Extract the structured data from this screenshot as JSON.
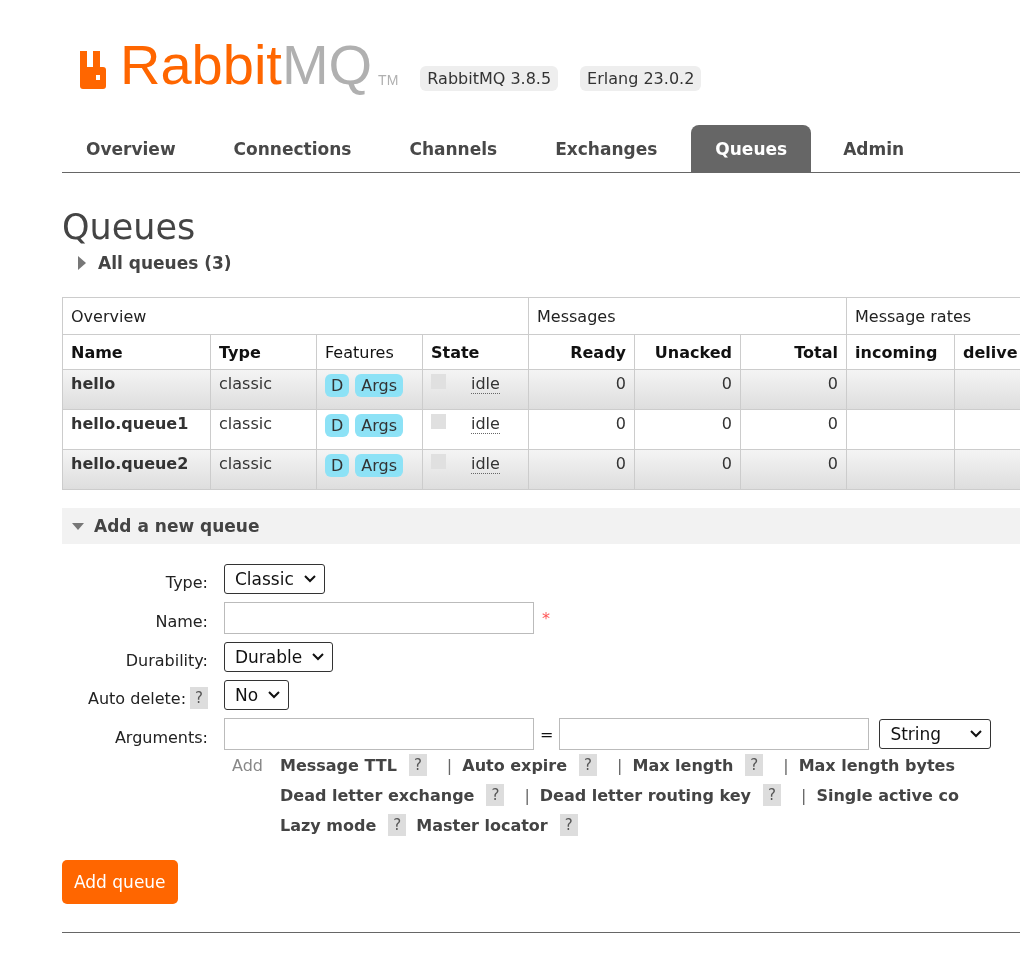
{
  "logo": {
    "brand": "Rabbit",
    "product": "MQ",
    "mark": "TM"
  },
  "versions": [
    "RabbitMQ 3.8.5",
    "Erlang 23.0.2"
  ],
  "tabs": [
    {
      "label": "Overview",
      "selected": false
    },
    {
      "label": "Connections",
      "selected": false
    },
    {
      "label": "Channels",
      "selected": false
    },
    {
      "label": "Exchanges",
      "selected": false
    },
    {
      "label": "Queues",
      "selected": true
    },
    {
      "label": "Admin",
      "selected": false
    }
  ],
  "page_title": "Queues",
  "all_queues": {
    "label": "All queues (3)",
    "expanded": false
  },
  "table": {
    "groups": [
      "Overview",
      "Messages",
      "Message rates"
    ],
    "columns": [
      "Name",
      "Type",
      "Features",
      "State",
      "Ready",
      "Unacked",
      "Total",
      "incoming",
      "delive"
    ],
    "rows": [
      {
        "name": "hello",
        "type": "classic",
        "features": [
          "D",
          "Args"
        ],
        "state": "idle",
        "ready": "0",
        "unacked": "0",
        "total": "0"
      },
      {
        "name": "hello.queue1",
        "type": "classic",
        "features": [
          "D",
          "Args"
        ],
        "state": "idle",
        "ready": "0",
        "unacked": "0",
        "total": "0"
      },
      {
        "name": "hello.queue2",
        "type": "classic",
        "features": [
          "D",
          "Args"
        ],
        "state": "idle",
        "ready": "0",
        "unacked": "0",
        "total": "0"
      }
    ]
  },
  "add_queue": {
    "label": "Add a new queue",
    "expanded": true,
    "fields": [
      {
        "label": "Type:",
        "kind": "select",
        "value": "Classic"
      },
      {
        "label": "Name:",
        "kind": "text",
        "required": "*"
      },
      {
        "label": "Durability:",
        "kind": "select",
        "value": "Durable"
      },
      {
        "label": "Auto delete:",
        "help": "?",
        "kind": "select",
        "value": "No"
      },
      {
        "label": "Arguments:",
        "kind": "args",
        "equals": "=",
        "value_type": "String"
      }
    ],
    "add_link": "Add",
    "arg_lines": [
      [
        {
          "label": "Message TTL",
          "help": "?",
          "separator": "|"
        },
        {
          "label": "Auto expire",
          "help": "?",
          "separator": "|"
        },
        {
          "label": "Max length",
          "help": "?",
          "separator": "|"
        },
        {
          "label": "Max length bytes"
        }
      ],
      [
        {
          "label": "Dead letter exchange",
          "help": "?",
          "separator": "|"
        },
        {
          "label": "Dead letter routing key",
          "help": "?",
          "separator": "|"
        },
        {
          "label": "Single active co"
        }
      ],
      [
        {
          "label": "Lazy mode",
          "help": "?"
        },
        {
          "label": "Master locator",
          "help": "?"
        }
      ]
    ],
    "submit": "Add queue"
  }
}
